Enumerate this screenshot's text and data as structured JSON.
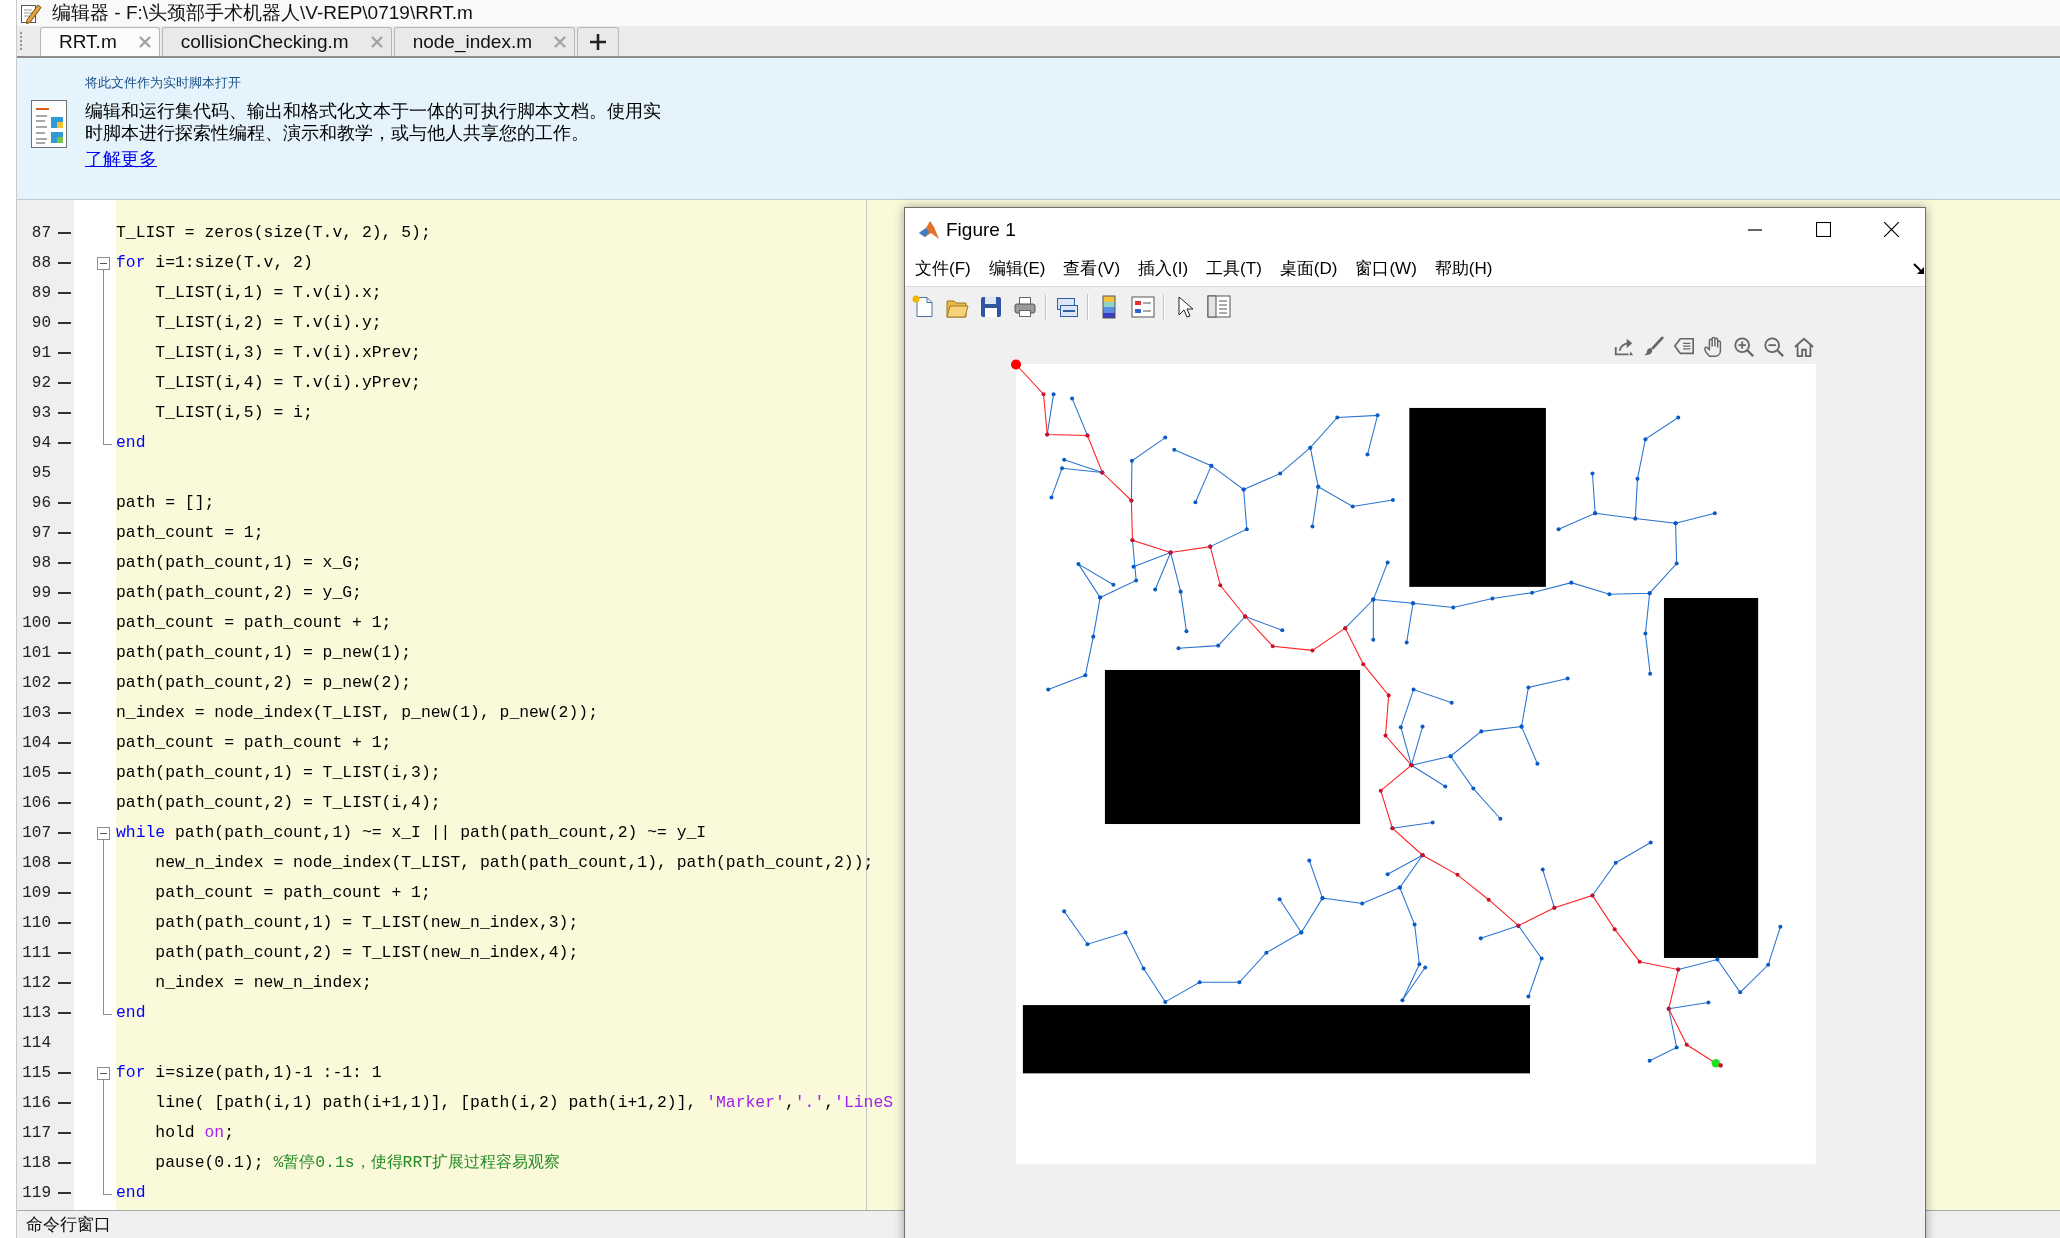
{
  "editor": {
    "title": "编辑器 - F:\\头颈部手术机器人\\V-REP\\0719\\RRT.m",
    "tabs": [
      {
        "label": "RRT.m",
        "selected": true
      },
      {
        "label": "collisionChecking.m",
        "selected": false
      },
      {
        "label": "node_index.m",
        "selected": false
      }
    ],
    "banner": {
      "heading": "将此文件作为实时脚本打开",
      "text": "编辑和运行集代码、输出和格式化文本于一体的可执行脚本文档。使用实时脚本进行探索性编程、演示和教学，或与他人共享您的工作。",
      "link": "了解更多"
    },
    "lines": [
      {
        "number": "87",
        "kind": "line",
        "executable": true,
        "code": [
          {
            "kind": "plain",
            "text": "T_LIST = zeros(size(T.v, 2), 5);"
          }
        ]
      },
      {
        "number": "88",
        "kind": "opener",
        "executable": true,
        "code": [
          {
            "kind": "keyword",
            "text": "for"
          },
          {
            "kind": "plain",
            "text": " i=1:size(T.v, 2)"
          }
        ],
        "children": [
          {
            "number": "89",
            "kind": "line",
            "executable": true,
            "code": [
              {
                "kind": "plain",
                "text": "T_LIST(i,1) = T.v(i).x;"
              }
            ]
          },
          {
            "number": "90",
            "kind": "line",
            "executable": true,
            "code": [
              {
                "kind": "plain",
                "text": "T_LIST(i,2) = T.v(i).y;"
              }
            ]
          },
          {
            "number": "91",
            "kind": "line",
            "executable": true,
            "code": [
              {
                "kind": "plain",
                "text": "T_LIST(i,3) = T.v(i).xPrev;"
              }
            ]
          },
          {
            "number": "92",
            "kind": "line",
            "executable": true,
            "code": [
              {
                "kind": "plain",
                "text": "T_LIST(i,4) = T.v(i).yPrev;"
              }
            ]
          },
          {
            "number": "93",
            "kind": "line",
            "executable": true,
            "code": [
              {
                "kind": "plain",
                "text": "T_LIST(i,5) = i;"
              }
            ]
          }
        ]
      },
      {
        "number": "94",
        "kind": "closer",
        "executable": true,
        "code": [
          {
            "kind": "keyword",
            "text": "end"
          }
        ]
      },
      {
        "number": "95",
        "kind": "line",
        "executable": false
      },
      {
        "number": "96",
        "kind": "line",
        "executable": true,
        "code": [
          {
            "kind": "plain",
            "text": "path = [];"
          }
        ]
      },
      {
        "number": "97",
        "kind": "line",
        "executable": true,
        "code": [
          {
            "kind": "plain",
            "text": "path_count = 1;"
          }
        ]
      },
      {
        "number": "98",
        "kind": "line",
        "executable": true,
        "code": [
          {
            "kind": "plain",
            "text": "path(path_count,1) = x_G;"
          }
        ]
      },
      {
        "number": "99",
        "kind": "line",
        "executable": true,
        "code": [
          {
            "kind": "plain",
            "text": "path(path_count,2) = y_G;"
          }
        ]
      },
      {
        "number": "100",
        "kind": "line",
        "executable": true,
        "code": [
          {
            "kind": "plain",
            "text": "path_count = path_count + 1;"
          }
        ]
      },
      {
        "number": "101",
        "kind": "line",
        "executable": true,
        "code": [
          {
            "kind": "plain",
            "text": "path(path_count,1) = p_new(1);"
          }
        ]
      },
      {
        "number": "102",
        "kind": "line",
        "executable": true,
        "code": [
          {
            "kind": "plain",
            "text": "path(path_count,2) = p_new(2);"
          }
        ]
      },
      {
        "number": "103",
        "kind": "line",
        "executable": true,
        "code": [
          {
            "kind": "plain",
            "text": "n_index = node_index(T_LIST, p_new(1), p_new(2));"
          }
        ]
      },
      {
        "number": "104",
        "kind": "line",
        "executable": true,
        "code": [
          {
            "kind": "plain",
            "text": "path_count = path_count + 1;"
          }
        ]
      },
      {
        "number": "105",
        "kind": "line",
        "executable": true,
        "code": [
          {
            "kind": "plain",
            "text": "path(path_count,1) = T_LIST(i,3);"
          }
        ]
      },
      {
        "number": "106",
        "kind": "line",
        "executable": true,
        "code": [
          {
            "kind": "plain",
            "text": "path(path_count,2) = T_LIST(i,4);"
          }
        ]
      },
      {
        "number": "107",
        "kind": "opener",
        "executable": true,
        "code": [
          {
            "kind": "keyword",
            "text": "while"
          },
          {
            "kind": "plain",
            "text": " path(path_count,1) ~= x_I || path(path_count,2) ~= y_I"
          }
        ],
        "children": [
          {
            "number": "108",
            "kind": "line",
            "executable": true,
            "code": [
              {
                "kind": "plain",
                "text": "new_n_index = node_index(T_LIST, path(path_count,1), path(path_count,2));"
              }
            ]
          },
          {
            "number": "109",
            "kind": "line",
            "executable": true,
            "code": [
              {
                "kind": "plain",
                "text": "path_count = path_count + 1;"
              }
            ]
          },
          {
            "number": "110",
            "kind": "line",
            "executable": true,
            "code": [
              {
                "kind": "plain",
                "text": "path(path_count,1) = T_LIST(new_n_index,3);"
              }
            ]
          },
          {
            "number": "111",
            "kind": "line",
            "executable": true,
            "code": [
              {
                "kind": "plain",
                "text": "path(path_count,2) = T_LIST(new_n_index,4);"
              }
            ]
          },
          {
            "number": "112",
            "kind": "line",
            "executable": true,
            "code": [
              {
                "kind": "plain",
                "text": "n_index = new_n_index;"
              }
            ]
          }
        ]
      },
      {
        "number": "113",
        "kind": "closer",
        "executable": true,
        "code": [
          {
            "kind": "keyword",
            "text": "end"
          }
        ]
      },
      {
        "number": "114",
        "kind": "line",
        "executable": false
      },
      {
        "number": "115",
        "kind": "opener",
        "executable": true,
        "code": [
          {
            "kind": "keyword",
            "text": "for"
          },
          {
            "kind": "plain",
            "text": " i=size(path,1)-1 :-1: 1"
          }
        ],
        "children": [
          {
            "number": "116",
            "kind": "line",
            "executable": true,
            "code": [
              {
                "kind": "plain",
                "text": "line( [path(i,1) path(i+1,1)], [path(i,2) path(i+1,2)], "
              },
              {
                "kind": "string",
                "text": "'Marker'"
              },
              {
                "kind": "plain",
                "text": ","
              },
              {
                "kind": "string",
                "text": "'.'"
              },
              {
                "kind": "plain",
                "text": ","
              },
              {
                "kind": "string",
                "text": "'LineS"
              }
            ]
          },
          {
            "number": "117",
            "kind": "line",
            "executable": true,
            "code": [
              {
                "kind": "plain",
                "text": "hold "
              },
              {
                "kind": "string",
                "text": "on"
              },
              {
                "kind": "plain",
                "text": ";"
              }
            ]
          },
          {
            "number": "118",
            "kind": "line",
            "executable": true,
            "code": [
              {
                "kind": "plain",
                "text": "pause(0.1); "
              },
              {
                "kind": "comment",
                "text": "%暂停0.1s，使得RRT扩展过程容易观察"
              }
            ]
          }
        ]
      },
      {
        "number": "119",
        "kind": "closer",
        "executable": true,
        "code": [
          {
            "kind": "keyword",
            "text": "end"
          }
        ]
      }
    ]
  },
  "command_window": {
    "title": "命令行窗口"
  },
  "figure": {
    "title": "Figure 1",
    "menu": [
      "文件(F)",
      "编辑(E)",
      "查看(V)",
      "插入(I)",
      "工具(T)",
      "桌面(D)",
      "窗口(W)",
      "帮助(H)"
    ]
  }
}
